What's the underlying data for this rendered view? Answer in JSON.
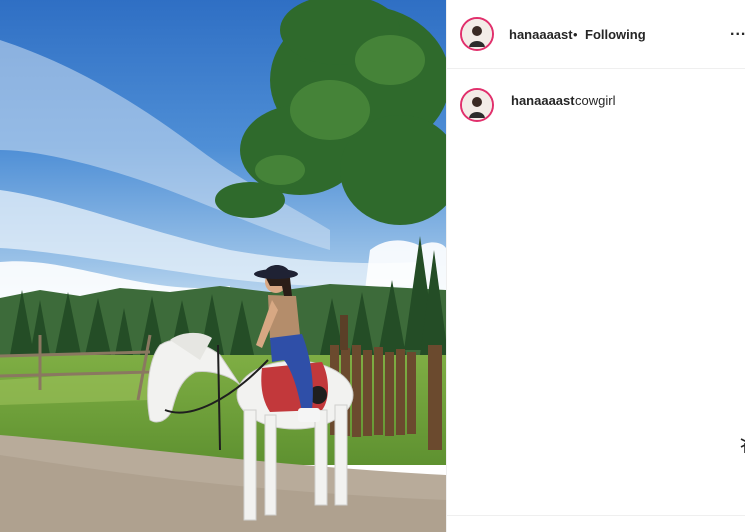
{
  "post": {
    "username": "hanaaaast",
    "separator": "•",
    "follow_status": "Following",
    "more_label": "...",
    "caption": {
      "username": "hanaaaast",
      "text": "cowgirl"
    }
  },
  "colors": {
    "text": "#262626",
    "avatar_ring": "#e1306c",
    "divider": "#efefef"
  },
  "icons": {
    "more": "more-options-icon",
    "edge": "share-icon"
  }
}
